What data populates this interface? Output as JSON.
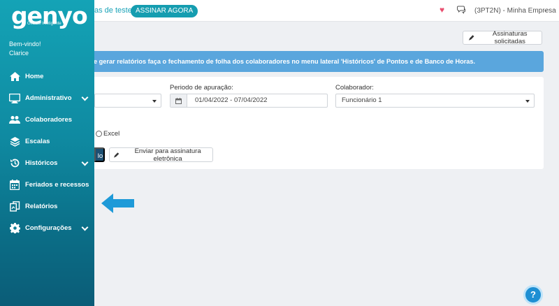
{
  "header": {
    "trial_text": "as de teste",
    "subscribe_label": "ASSINAR AGORA",
    "company_label": "(3PT2N) - Minha Empresa"
  },
  "sidebar": {
    "logo_text": "genyo",
    "logo_sub": "Gestão Inteligente",
    "welcome": "Bem-vindo!",
    "user_name": "Clarice",
    "items": [
      {
        "label": "Home",
        "icon": "home-icon",
        "has_submenu": false
      },
      {
        "label": "Administrativo",
        "icon": "monitor-icon",
        "has_submenu": true
      },
      {
        "label": "Colaboradores",
        "icon": "users-icon",
        "has_submenu": false
      },
      {
        "label": "Escalas",
        "icon": "layers-icon",
        "has_submenu": false
      },
      {
        "label": "Históricos",
        "icon": "history-icon",
        "has_submenu": true
      },
      {
        "label": "Feriados e recessos",
        "icon": "calendar-icon",
        "has_submenu": false
      },
      {
        "label": "Relatórios",
        "icon": "reports-icon",
        "has_submenu": false
      },
      {
        "label": "Configurações",
        "icon": "gear-icon",
        "has_submenu": true
      }
    ]
  },
  "toolbar": {
    "signed_requests_label": "Assinaturas solicitadas"
  },
  "alert": {
    "text": "e gerar relatórios faça o fechamento de folha dos colaboradores no menu lateral 'Históricos' de Pontos e de Banco de Horas."
  },
  "form": {
    "period_label": "Periodo de apuração:",
    "period_value": "01/04/2022 - 07/04/2022",
    "collaborator_label": "Colaborador:",
    "collaborator_value": "Funcionário 1",
    "excel_label": "Excel",
    "generate_label": "lo",
    "send_signature_label": "Enviar para assinatura eletrônica"
  },
  "help": {
    "label": "?"
  },
  "colors": {
    "accent": "#159db0",
    "alert": "#5aa6dd",
    "arrow": "#1e9ad8"
  }
}
